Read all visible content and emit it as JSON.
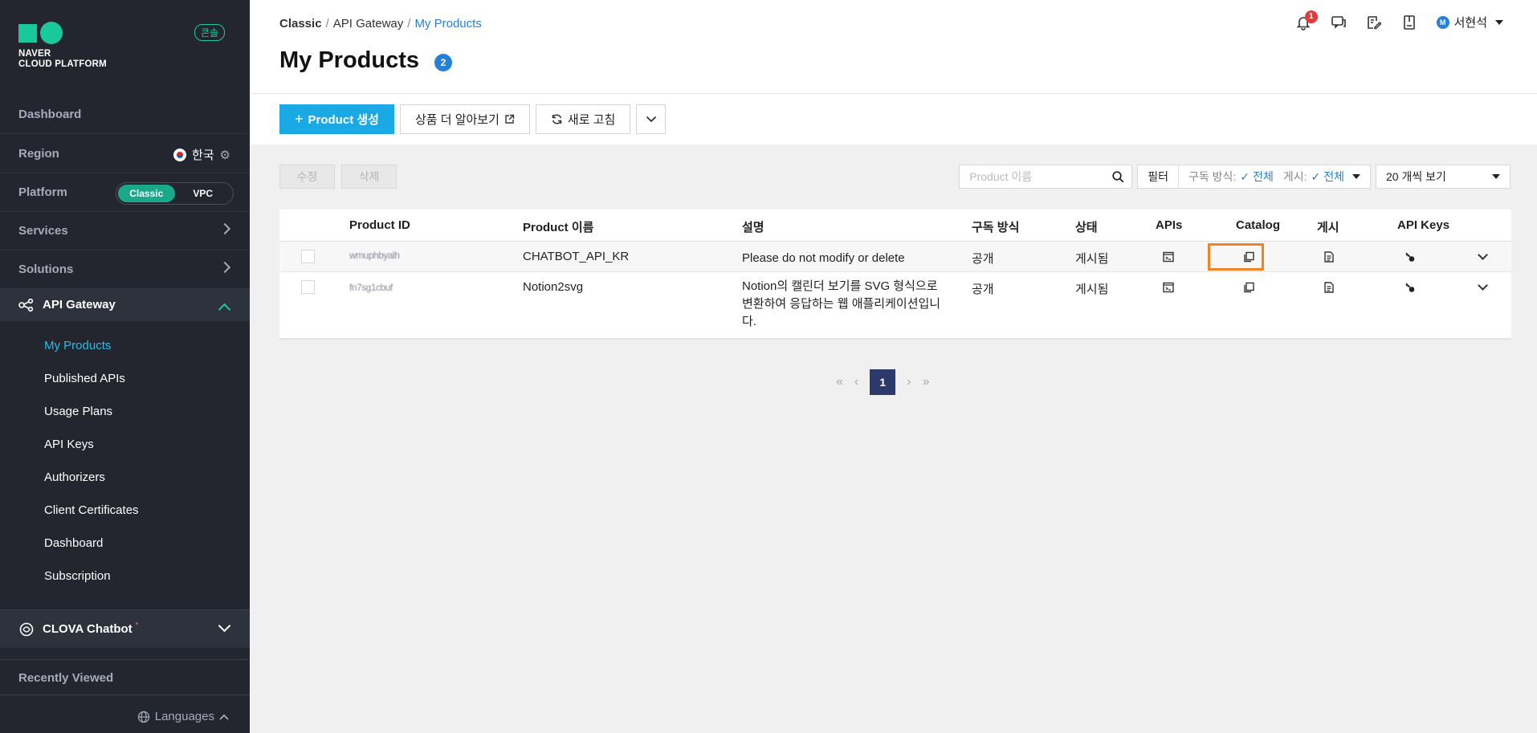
{
  "sidebar": {
    "logo_line1": "NAVER",
    "logo_line2": "CLOUD PLATFORM",
    "console_badge": "콘솔",
    "dashboard": "Dashboard",
    "region_label": "Region",
    "region_value": "한국",
    "platform_label": "Platform",
    "platform_options": [
      "Classic",
      "VPC"
    ],
    "platform_selected": "Classic",
    "services": "Services",
    "solutions": "Solutions",
    "api_gateway": "API Gateway",
    "submenu": [
      "My Products",
      "Published APIs",
      "Usage Plans",
      "API Keys",
      "Authorizers",
      "Client Certificates",
      "Dashboard",
      "Subscription"
    ],
    "submenu_active": "My Products",
    "clova": "CLOVA Chatbot",
    "clova_dot": "•",
    "recently_viewed": "Recently Viewed",
    "languages": "Languages"
  },
  "header": {
    "breadcrumb": [
      "Classic",
      "API Gateway",
      "My Products"
    ],
    "title": "My Products",
    "count": "2",
    "notification_count": "1",
    "user_initial": "M",
    "user_name": "서현석"
  },
  "toolbar": {
    "create_label": "Product 생성",
    "learn_more_label": "상품 더 알아보기",
    "refresh_label": "새로 고침",
    "edit_label": "수정",
    "delete_label": "삭제"
  },
  "filters": {
    "search_placeholder": "Product 이름",
    "filter_label": "필터",
    "subscribe_label": "구독 방식:",
    "subscribe_value": "전체",
    "publish_label": "게시:",
    "publish_value": "전체",
    "per_page": "20 개씩 보기"
  },
  "table": {
    "columns": [
      "Product ID",
      "Product 이름",
      "설명",
      "구독 방식",
      "상태",
      "APIs",
      "Catalog",
      "게시",
      "API Keys"
    ],
    "rows": [
      {
        "id": "wmuphbyalh",
        "name": "CHATBOT_API_KR",
        "description": "Please do not modify or delete",
        "subscription": "공개",
        "status": "게시됨"
      },
      {
        "id": "fn7sg1cbuf",
        "name": "Notion2svg",
        "description": "Notion의 캘린더 보기를 SVG 형식으로 변환하여 응답하는 웹 애플리케이션입니다.",
        "subscription": "공개",
        "status": "게시됨"
      }
    ]
  },
  "pagination": {
    "current": "1"
  },
  "colors": {
    "sidebar_bg": "#23262f",
    "accent_green": "#19c99a",
    "primary_blue": "#1ba9e6",
    "link_blue": "#2680d8",
    "highlight_orange": "#f58220"
  }
}
